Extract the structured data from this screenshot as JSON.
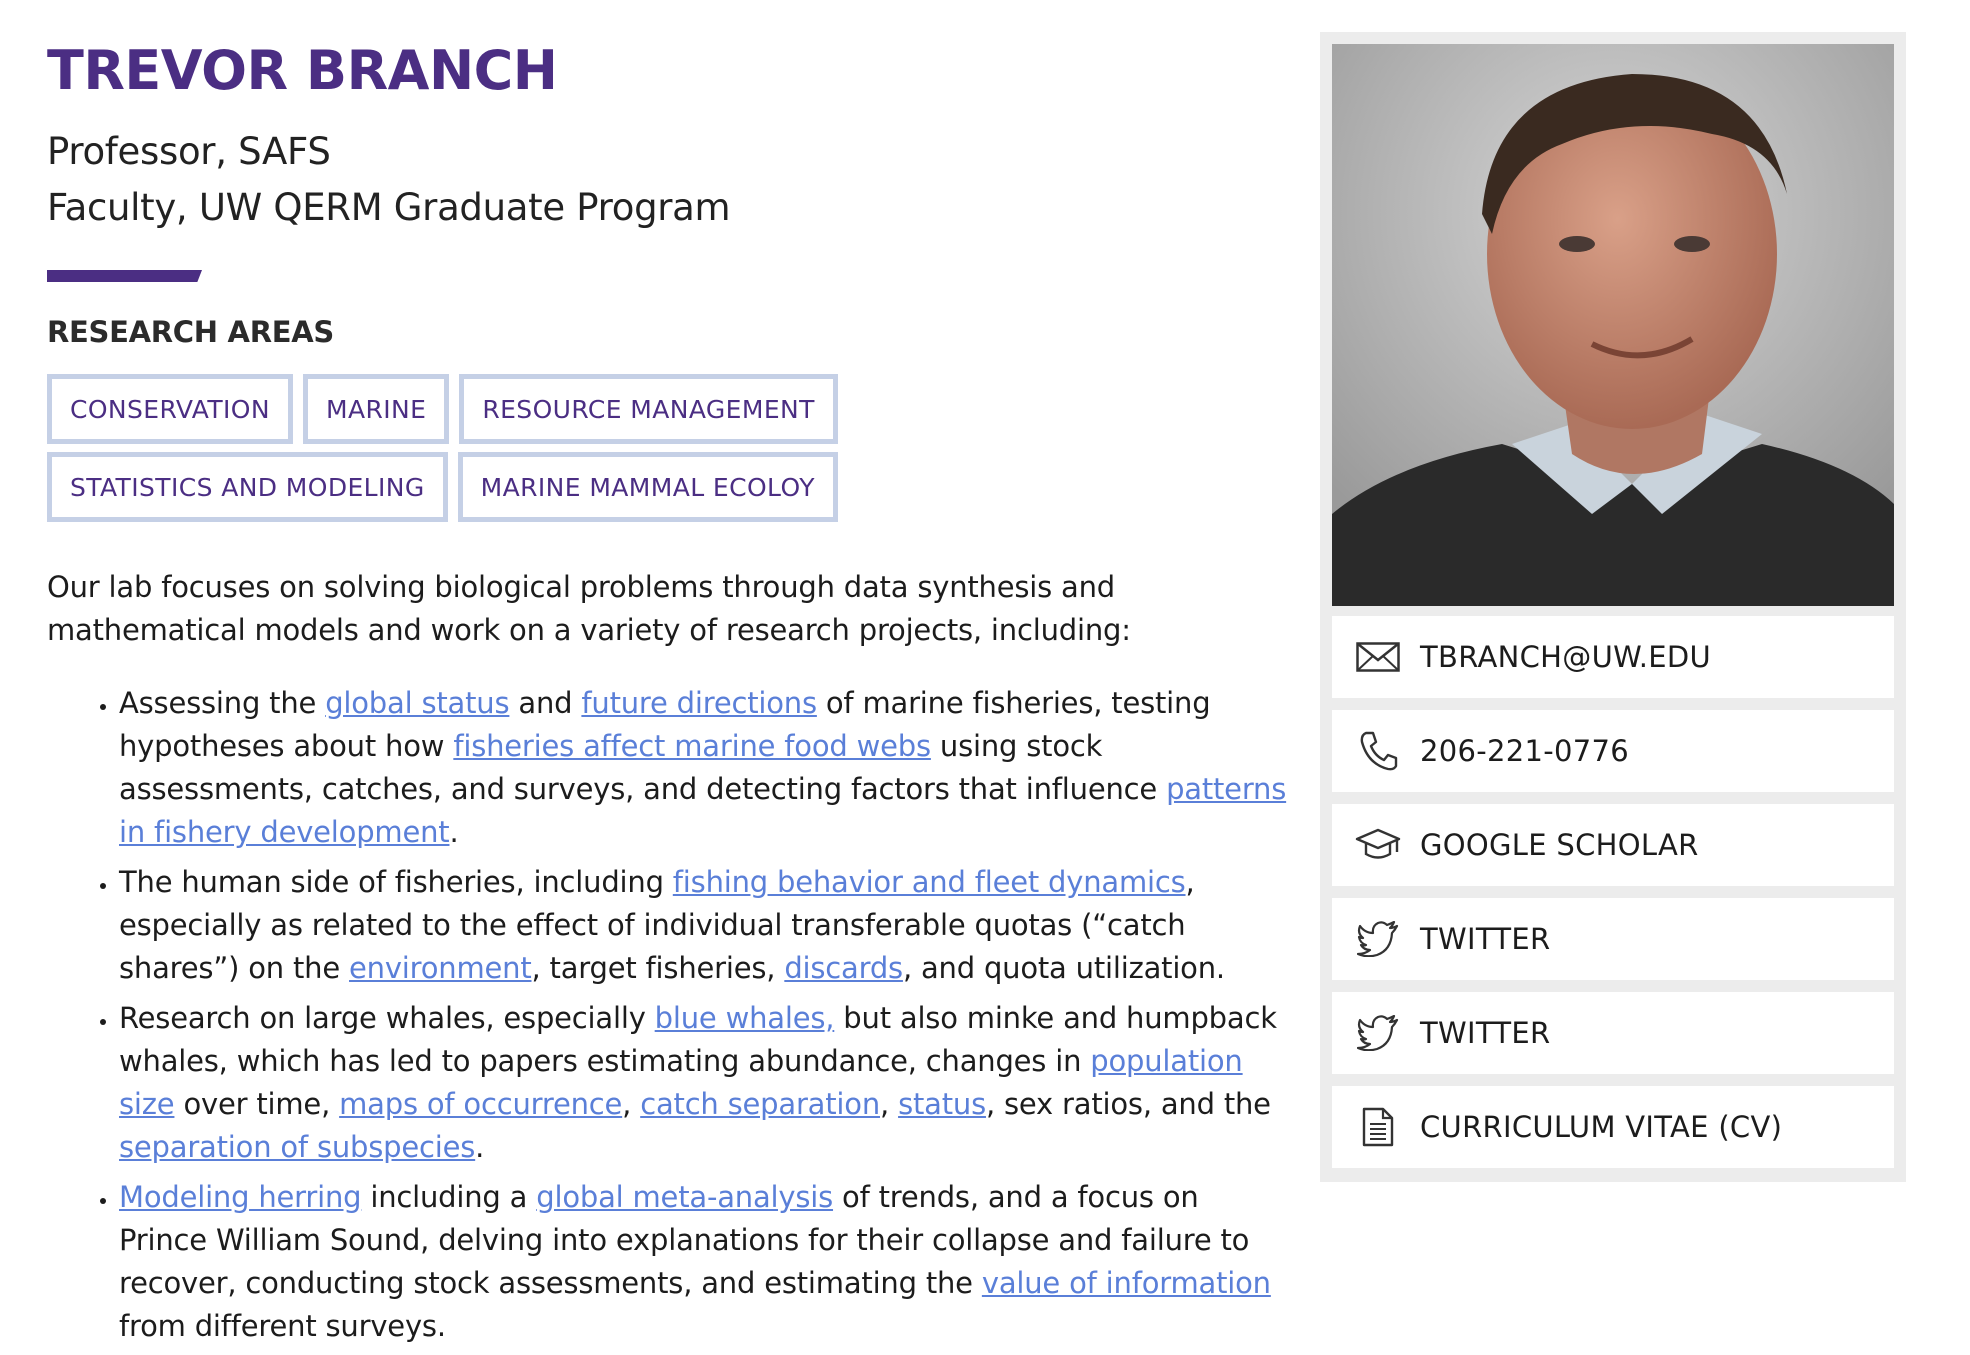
{
  "profile": {
    "name": "TREVOR BRANCH",
    "title_line_1": "Professor, SAFS",
    "title_line_2": "Faculty, UW QERM Graduate Program"
  },
  "research_areas": {
    "heading": "RESEARCH AREAS",
    "tags": [
      "CONSERVATION",
      "MARINE",
      "RESOURCE MANAGEMENT",
      "STATISTICS AND MODELING",
      "MARINE MAMMAL ECOLOY"
    ]
  },
  "intro": "Our lab focuses on solving biological problems through data synthesis and mathematical models and work on a variety of research projects, including:",
  "bullets": [
    [
      "Assessing the ",
      {
        "link": "global status"
      },
      " and ",
      {
        "link": "future directions"
      },
      " of marine fisheries, testing hypotheses about how ",
      {
        "link": "fisheries affect marine food webs"
      },
      " using stock assessments, catches, and surveys, and detecting factors that influence ",
      {
        "link": "patterns in fishery development"
      },
      "."
    ],
    [
      "The human side of fisheries, including ",
      {
        "link": "fishing behavior and fleet dynamics"
      },
      ", especially as related to the effect of individual transferable quotas (“catch shares”) on the ",
      {
        "link": "environment"
      },
      ", target fisheries, ",
      {
        "link": "discards"
      },
      ", and quota utilization."
    ],
    [
      "Research on large whales, especially ",
      {
        "link": "blue whales,"
      },
      " but also minke and humpback whales, which has led to papers estimating abundance, changes in ",
      {
        "link": "population size"
      },
      " over time, ",
      {
        "link": "maps of occurrence"
      },
      ", ",
      {
        "link": "catch separation"
      },
      ", ",
      {
        "link": "status"
      },
      ", sex ratios, and the ",
      {
        "link": "separation of subspecies"
      },
      "."
    ],
    [
      {
        "link": "Modeling herring"
      },
      " including a ",
      {
        "link": "global meta-analysis"
      },
      " of trends, and a focus on Prince William Sound, delving into explanations for their collapse and failure to recover, conducting stock assessments, and estimating the ",
      {
        "link": "value of information"
      },
      " from different surveys."
    ]
  ],
  "sidebar": {
    "contacts": [
      {
        "icon": "envelope-icon",
        "label": "TBRANCH@UW.EDU"
      },
      {
        "icon": "phone-icon",
        "label": "206-221-0776"
      },
      {
        "icon": "graduation-cap-icon",
        "label": "GOOGLE SCHOLAR"
      },
      {
        "icon": "twitter-bird-icon",
        "label": "TWITTER"
      },
      {
        "icon": "twitter-bird-icon",
        "label": "TWITTER"
      },
      {
        "icon": "document-icon",
        "label": "CURRICULUM VITAE (CV)"
      }
    ]
  },
  "colors": {
    "brand_purple": "#4b2e83",
    "link_blue": "#5a7fd8",
    "tag_border": "#c5d0e6",
    "sidebar_bg": "#ececec"
  }
}
